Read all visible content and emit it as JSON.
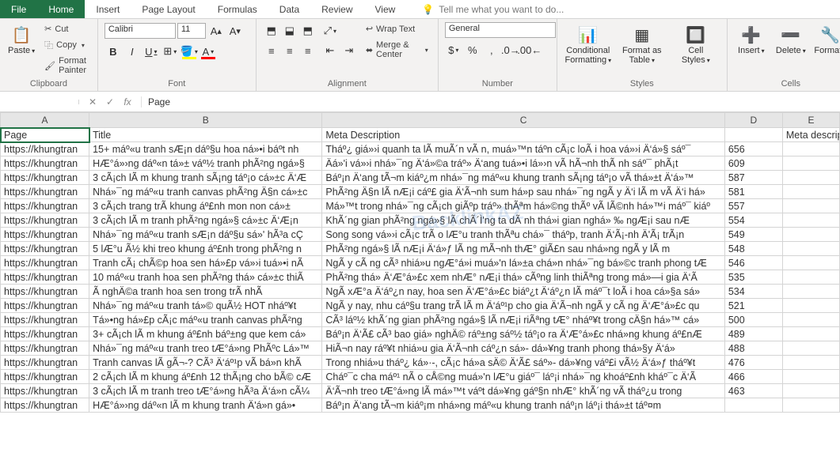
{
  "tabs": {
    "file": "File",
    "home": "Home",
    "insert": "Insert",
    "page_layout": "Page Layout",
    "formulas": "Formulas",
    "data": "Data",
    "review": "Review",
    "view": "View",
    "tellme": "Tell me what you want to do..."
  },
  "ribbon": {
    "clipboard": {
      "label": "Clipboard",
      "paste": "Paste",
      "cut": "Cut",
      "copy": "Copy",
      "format_painter": "Format Painter"
    },
    "font": {
      "label": "Font",
      "name": "Calibri",
      "size": "11"
    },
    "alignment": {
      "label": "Alignment",
      "wrap": "Wrap Text",
      "merge": "Merge & Center"
    },
    "number": {
      "label": "Number",
      "format": "General"
    },
    "styles": {
      "label": "Styles",
      "cond": "Conditional Formatting",
      "table": "Format as Table",
      "cell": "Cell Styles"
    },
    "cells": {
      "label": "Cells",
      "insert": "Insert",
      "delete": "Delete",
      "format": "Format"
    }
  },
  "formula_bar": {
    "name_box": "",
    "fx_label": "fx",
    "value": "Page"
  },
  "columns": [
    "A",
    "B",
    "C",
    "D",
    "E"
  ],
  "headers": {
    "A": "Page",
    "B": "Title",
    "C": "Meta Description",
    "D": "",
    "E": "Meta description length"
  },
  "rows": [
    {
      "a": "https://khungtran",
      "b": "15+ máº«u tranh sÆ¡n dáº§u hoa ná»•i báº­t nh",
      "c": "Tháº¿ giá»›i quanh ta lÃ  muÃ´n vÃ n, muá»™n táº­n cÃ¡c loÃ i hoa vá»›i Ä‘á»§ sáº¯",
      "d": "656",
      "e": ""
    },
    {
      "a": "https://khungtran",
      "b": "HÆ°á»›ng dáº«n tá»± váº½ tranh phÃ²ng ngá»§",
      "c": "Äá»'i vá»›i nhá»¯ng Ä‘á»©a tráº» Ä‘ang tuá»•i lá»›n vÃ  hÃ¬nh thÃ nh sáº¯ phÃ¡t",
      "d": "609",
      "e": ""
    },
    {
      "a": "https://khungtran",
      "b": "3 cÃ¡ch lÃ m khung tranh sÃ¡ng táº¡o cá»±c Ä‘Æ",
      "c": "Báº¡n Ä‘ang tÃ¬m kiáº¿m nhá»¯ng máº«u khung tranh sÃ¡ng táº¡o vÃ  thá»±t Ä‘á»™",
      "d": "587",
      "e": ""
    },
    {
      "a": "https://khungtran",
      "b": "Nhá»¯ng máº«u tranh canvas phÃ²ng Ä§n cá»±c",
      "c": "PhÃ²ng Ä§n lÃ  nÆ¡i cáº£ gia Ä‘Ã¬nh sum há»p sau nhá»¯ng ngÃ y Ä‘i lÃ m vÃ  Ä‘i há»",
      "d": "581",
      "e": ""
    },
    {
      "a": "https://khungtran",
      "b": "3 cÃ¡ch trang trÃ­ khung áº£nh mon non cá»±",
      "c": "Má»™t trong nhá»¯ng cÃ¡ch giÃºp tráº» thÃªm há»©ng thÃº vÃ  lÃ©nh há»™i máº¯ kiáº",
      "d": "557",
      "e": ""
    },
    {
      "a": "https://khungtran",
      "b": "3 cÃ¡ch lÃ m tranh phÃ²ng ngá»§ cá»±c Ä‘Æ¡n",
      "c": "KhÃ´ng gian phÃ²ng ngá»§ lÃ  chÃ´Ì'ng ta dÃ nh thá»i gian nghá» ‰ ngÆ¡i sau nÆ",
      "d": "554",
      "e": ""
    },
    {
      "a": "https://khungtran",
      "b": "Nhá»¯ng máº«u tranh sÆ¡n dáº§u sá»' hÃ³a cÇ",
      "c": "Song song vá»›i cÃ¡c trÃ  o lÆ°u tranh thÃªu chá»¯ tháº­p, tranh Ä‘Ã¡-nh Ä'Ã¡ trÃ¡n",
      "d": "549",
      "e": ""
    },
    {
      "a": "https://khungtran",
      "b": "5 lÆ°u Ã½ khi treo khung áº£nh trong phÃ²ng n",
      "c": "PhÃ²ng ngá»§ lÃ  nÆ¡i Ä‘á»ƒ lÃ ng mÃ¬nh thÆ° giÃ£n sau nhá»ng ngÃ y lÃ m",
      "d": "548",
      "e": ""
    },
    {
      "a": "https://khungtran",
      "b": "Tranh cÃ¡ chÃ©p hoa sen há»£p vá»›i tuá»•i nÃ",
      "c": "NgÃ y cÃ ng cÃ³ nhiá»u ngÆ°á»i muá»'n lá»±a chá»n nhá»¯ng bá»©c tranh phong tÆ",
      "d": "546",
      "e": ""
    },
    {
      "a": "https://khungtran",
      "b": "10 máº«u tranh hoa sen phÃ²ng thá» cá»±c thiÃ",
      "c": "PhÃ²ng thá» Ä‘Æ°á»£c xem nhÆ° nÆ¡i thá» cÃºng linh thiÃªng trong má»—i gia Ä‘Ã",
      "d": "535",
      "e": ""
    },
    {
      "a": "https://khungtran",
      "b": "Ã nghÄ©a tranh hoa sen trong trÃ­ nhÃ",
      "c": "NgÃ xÆ°a Ä‘áº¿n nay, hoa sen Ä‘Æ°á»£c biáº¿t Ä‘áº¿n lÃ  máº¯t loÃ i hoa cá»§a sá»",
      "d": "534",
      "e": ""
    },
    {
      "a": "https://khungtran",
      "b": "Nhá»¯ng máº«u tranh tá»© quÃ½ HOT nháº¥t",
      "c": "NgÃ y nay, nhu cáº§u trang trÃ­ lÃ m Ä‘áº¹p cho gia Ä‘Ã¬nh ngÃ y cÃ ng Ä‘Æ°á»£c qu",
      "d": "521",
      "e": ""
    },
    {
      "a": "https://khungtran",
      "b": "Tá»•ng há»£p cÃ¡c máº«u tranh canvas phÃ²ng",
      "c": "CÃ³ láº½ khÃ´ng gian phÃ²ng ngá»§ lÃ  nÆ¡i riÃªng tÆ° nháº¥t trong cÄ§n há»™ cá»",
      "d": "500",
      "e": ""
    },
    {
      "a": "https://khungtran",
      "b": "3+ cÃ¡ch lÃ m khung áº£nh báº±ng que kem cá»",
      "c": "Báº¡n Ä‘Ã£ cÃ³ bao giá» nghÄ© ráº±ng sáº½ táº¡o ra Ä‘Æ°á»£c nhá»ng khung áº£nÆ",
      "d": "489",
      "e": ""
    },
    {
      "a": "https://khungtran",
      "b": "Nhá»¯ng máº«u tranh treo tÆ°á»ng PhÃºc Lá»™",
      "c": "HiÃ¬n nay ráº¥t nhiá»u gia Ä‘Ã¬nh cáº¿n sá»­- dá»¥ng tranh phong thá»§y Ä‘á»",
      "d": "488",
      "e": ""
    },
    {
      "a": "https://khungtran",
      "b": "Tranh canvas lÃ  gÃ¬-? CÃ³ Ä‘áº¹p vÃ  bá»n khÃ",
      "c": "Trong nhiá»u tháº¿ ká»·-, cÃ¡c há»a sÄ© Ä‘Ã£ sáº»- dá»¥ng váº£i vÃ½ Ä‘á»ƒ tháº¥t",
      "d": "476",
      "e": ""
    },
    {
      "a": "https://khungtran",
      "b": "2 cÃ¡ch lÃ m khung áº£nh 12 thÃ¡ng cho bÃ© cÆ",
      "c": "Cháº¯c cha máº¹ nÃ o cÅ©ng muá»'n lÆ°u giáº¯ láº¡i nhá»¯ng khoáº£nh kháº¯c Ä‘Ã",
      "d": "466",
      "e": ""
    },
    {
      "a": "https://khungtran",
      "b": "3 cÃ¡ch lÃ m tranh treo tÆ°á»ng hÃ³a Ä‘á»n cÃ¼",
      "c": "Ä‘Ã¬nh treo tÆ°á»ng lÃ  má»™t váº­t dá»¥ng gáº§n nhÆ° khÃ´ng vÃ  tháº¿u trong",
      "d": "463",
      "e": ""
    },
    {
      "a": "https://khungtran",
      "b": "HÆ°á»›ng dáº«n lÃ m khung tranh Ä'á»n gá»•",
      "c": "Báº¡n Ä‘ang tÃ¬m kiáº¡m nhá»ng máº«u khung tranh náº¡n láº¡i thá»±t táº¤m",
      "d": "",
      "e": ""
    }
  ],
  "watermark": {
    "main": "BacklinkAZ",
    "sub": ""
  }
}
